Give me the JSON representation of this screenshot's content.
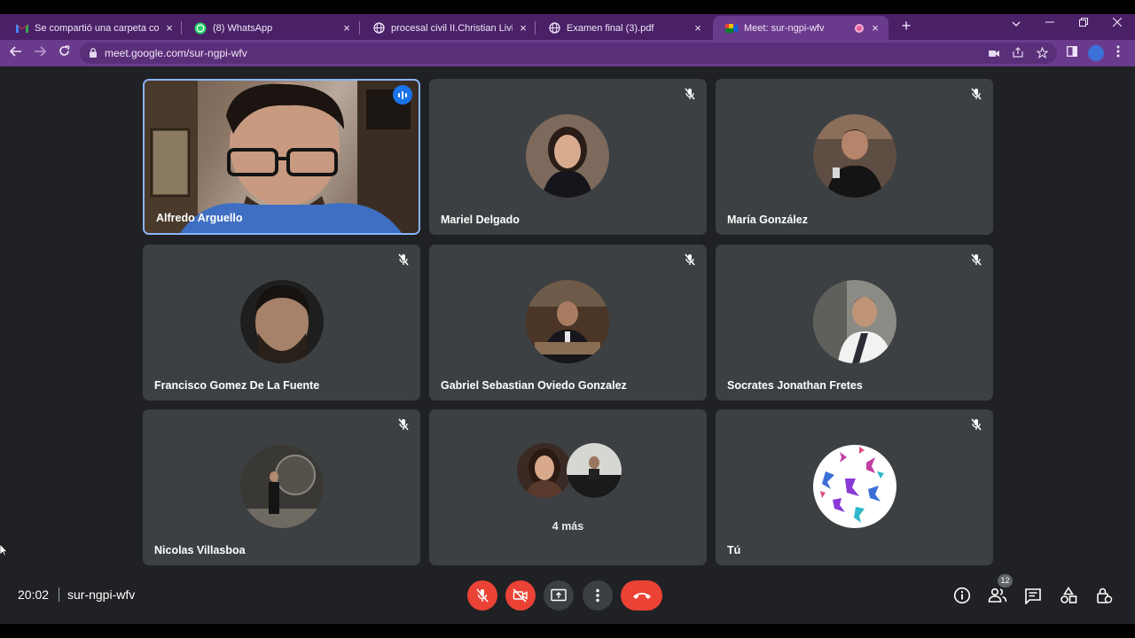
{
  "browser": {
    "tabs": [
      {
        "title": "Se compartió una carpeta contigo",
        "favicon": "gmail-icon"
      },
      {
        "title": "(8) WhatsApp",
        "favicon": "whatsapp-icon"
      },
      {
        "title": "procesal civil II.Christian Livieres",
        "favicon": "globe-icon"
      },
      {
        "title": "Examen final (3).pdf",
        "favicon": "globe-icon"
      },
      {
        "title": "Meet: sur-ngpi-wfv",
        "favicon": "meet-icon"
      }
    ],
    "new_tab_symbol": "+",
    "close_symbol": "×",
    "url": "meet.google.com/sur-ngpi-wfv"
  },
  "meeting": {
    "participants": [
      {
        "name": "Alfredo Arguello",
        "muted": false,
        "speaking": true
      },
      {
        "name": "Mariel Delgado",
        "muted": true
      },
      {
        "name": "María González",
        "muted": true
      },
      {
        "name": "Francisco Gomez De La Fuente",
        "muted": true
      },
      {
        "name": "Gabriel Sebastian Oviedo Gonzalez",
        "muted": true
      },
      {
        "name": "Socrates Jonathan Fretes",
        "muted": true
      },
      {
        "name": "Nicolas Villasboa",
        "muted": true
      },
      {
        "name": "Tú",
        "muted": true
      }
    ],
    "overflow_label": "4 más",
    "time": "20:02",
    "code": "sur-ngpi-wfv",
    "participant_count": "12"
  },
  "colors": {
    "tabstrip": "#4a2167",
    "toolbar": "#6a3b8d",
    "stage": "#202124",
    "tile": "#3c4043",
    "danger": "#ea4335",
    "speaking_border": "#8ab4f8"
  }
}
